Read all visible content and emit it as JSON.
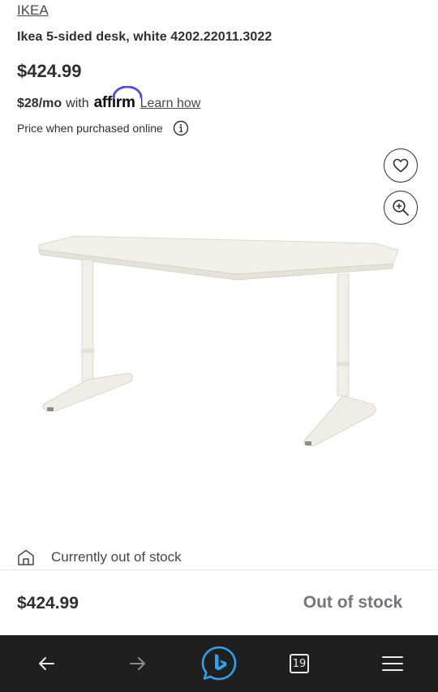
{
  "product": {
    "brand": "IKEA",
    "title": "Ikea 5-sided desk, white 4202.22011.3022",
    "price": "$424.99"
  },
  "affirm": {
    "monthly": "$28/mo",
    "with": "with",
    "logo_text": "affirm",
    "learn_label": "Learn how"
  },
  "online_note": "Price when purchased online",
  "icons": {
    "info": "info-icon",
    "favorite": "heart-icon",
    "zoom": "zoom-in-icon",
    "store": "store-icon",
    "back": "arrow-left-icon",
    "forward": "arrow-right-icon",
    "bing": "bing-chat-icon",
    "menu": "hamburger-menu-icon"
  },
  "stock": {
    "status_text": "Currently out of stock"
  },
  "sticky": {
    "price": "$424.99",
    "button_label": "Out of stock"
  },
  "browser": {
    "tab_count": "19"
  },
  "colors": {
    "text": "#2e2f32",
    "muted": "#74767c",
    "affirm_blue": "#4a4af4",
    "bing_blue": "#2aa3f0",
    "toolbar_bg": "#1f1f1f"
  }
}
